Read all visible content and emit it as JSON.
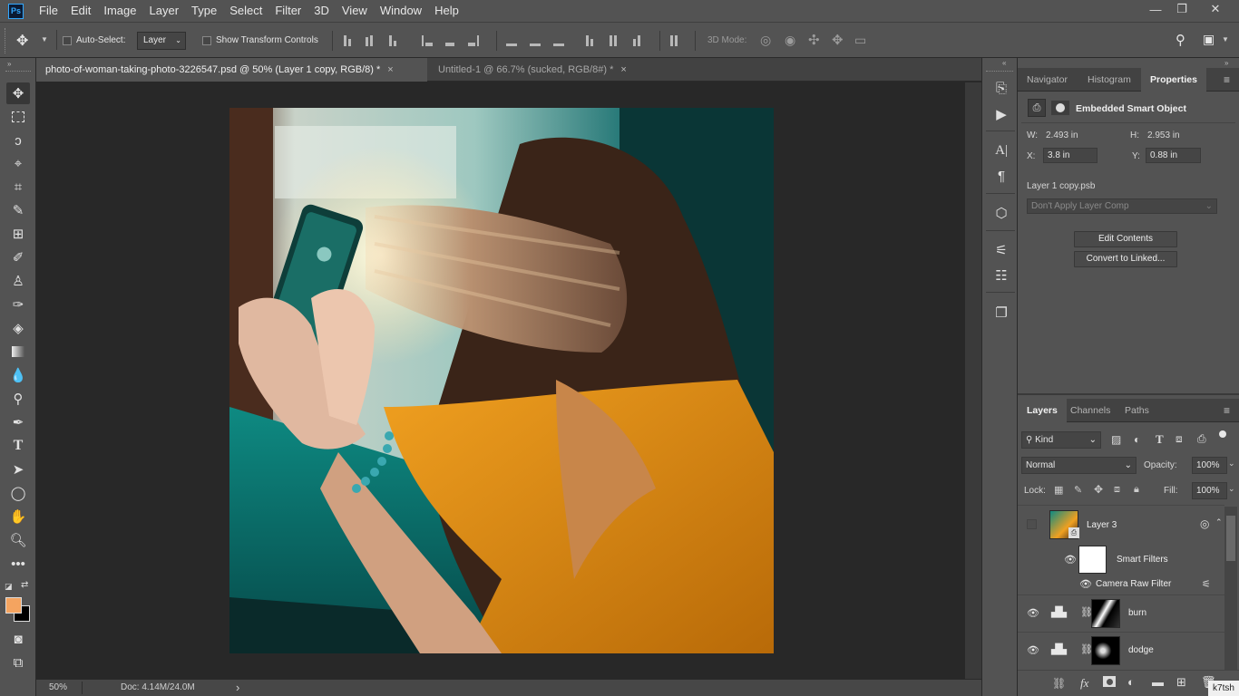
{
  "app": {
    "logo": "Ps",
    "watermark": "k7tsh"
  },
  "menu": [
    "File",
    "Edit",
    "Image",
    "Layer",
    "Type",
    "Select",
    "Filter",
    "3D",
    "View",
    "Window",
    "Help"
  ],
  "window_controls": {
    "minimize": "—",
    "restore": "❐",
    "close": "✕"
  },
  "options_bar": {
    "auto_select_label": "Auto-Select:",
    "auto_select_value": "Layer",
    "show_transform_label": "Show Transform Controls",
    "mode_3d_label": "3D Mode:"
  },
  "tabs": [
    {
      "title": "photo-of-woman-taking-photo-3226547.psd @ 50% (Layer 1 copy, RGB/8) *",
      "close": "×",
      "active": true
    },
    {
      "title": "Untitled-1 @ 66.7% (sucked, RGB/8#) *",
      "close": "×",
      "active": false
    }
  ],
  "status": {
    "zoom": "50%",
    "doc": "Doc: 4.14M/24.0M",
    "arrow": "›"
  },
  "colors": {
    "foreground": "#f4a460",
    "background": "#000000",
    "accent": "#31a8ff"
  },
  "properties_panel": {
    "tabs": [
      "Navigator",
      "Histogram",
      "Properties"
    ],
    "object_type": "Embedded Smart Object",
    "w_label": "W:",
    "w_value": "2.493 in",
    "h_label": "H:",
    "h_value": "2.953 in",
    "x_label": "X:",
    "x_value": "3.8 in",
    "y_label": "Y:",
    "y_value": "0.88 in",
    "filename": "Layer 1 copy.psb",
    "layer_comp_placeholder": "Don't Apply Layer Comp",
    "edit_contents": "Edit Contents",
    "convert_linked": "Convert to Linked..."
  },
  "layers_panel": {
    "tabs": [
      "Layers",
      "Channels",
      "Paths"
    ],
    "filter_kind": "Kind",
    "blend_mode": "Normal",
    "opacity_label": "Opacity:",
    "opacity_value": "100%",
    "lock_label": "Lock:",
    "fill_label": "Fill:",
    "fill_value": "100%",
    "layers": [
      {
        "name": "Layer 3"
      },
      {
        "name": "Smart Filters"
      },
      {
        "name": "Camera Raw Filter"
      },
      {
        "name": "burn"
      },
      {
        "name": "dodge"
      }
    ],
    "bottom_fx": "fx"
  }
}
